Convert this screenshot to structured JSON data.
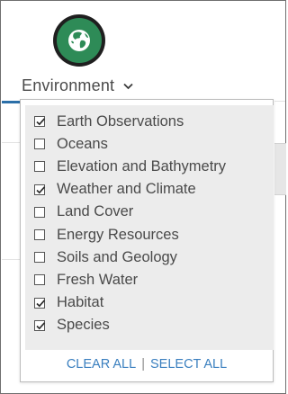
{
  "category": {
    "label": "Environment",
    "icon": "globe-icon",
    "icon_color": "#2e8b57",
    "icon_ring_color": "#1f1f1f"
  },
  "dropdown": {
    "options": [
      {
        "label": "Earth Observations",
        "checked": true
      },
      {
        "label": "Oceans",
        "checked": false
      },
      {
        "label": "Elevation and Bathymetry",
        "checked": false
      },
      {
        "label": "Weather and Climate",
        "checked": true
      },
      {
        "label": "Land Cover",
        "checked": false
      },
      {
        "label": "Energy Resources",
        "checked": false
      },
      {
        "label": "Soils and Geology",
        "checked": false
      },
      {
        "label": "Fresh Water",
        "checked": false
      },
      {
        "label": "Habitat",
        "checked": true
      },
      {
        "label": "Species",
        "checked": true
      }
    ],
    "clear_all_label": "CLEAR ALL",
    "separator": "|",
    "select_all_label": "SELECT ALL"
  },
  "colors": {
    "link": "#3a7fbf",
    "panel_bg": "#ececec",
    "text": "#4a4a4a"
  }
}
